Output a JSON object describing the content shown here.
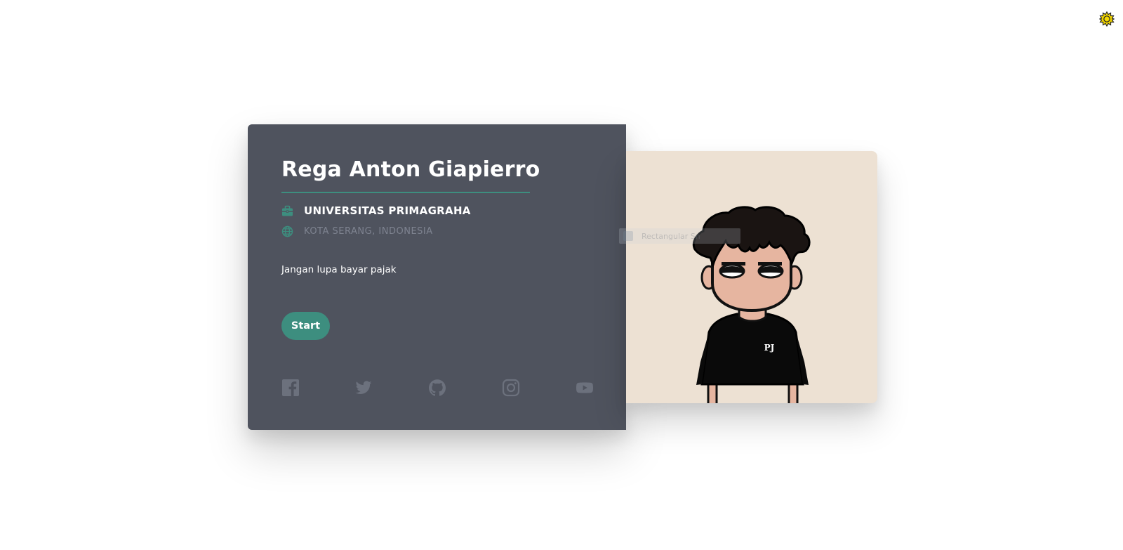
{
  "profile": {
    "name": "Rega Anton Giapierro",
    "institution": "UNIVERSITAS PRIMAGRAHA",
    "location": "KOTA SERANG, INDONESIA",
    "tagline": "Jangan lupa bayar pajak",
    "start_label": "Start"
  },
  "icons": {
    "theme_toggle": "sun-icon",
    "institution": "briefcase-icon",
    "location": "globe-icon",
    "social": [
      "facebook-icon",
      "twitter-icon",
      "github-icon",
      "instagram-icon",
      "youtube-icon"
    ]
  },
  "overlay": {
    "capture_label": "Rectangular Sn"
  },
  "avatar": {
    "shirt_logo": "PJ"
  },
  "colors": {
    "card_bg": "#4f535e",
    "accent": "#3d8e7f",
    "portrait_bg": "#ede1d3",
    "muted": "#7e8390",
    "sun": "#f5d800"
  }
}
